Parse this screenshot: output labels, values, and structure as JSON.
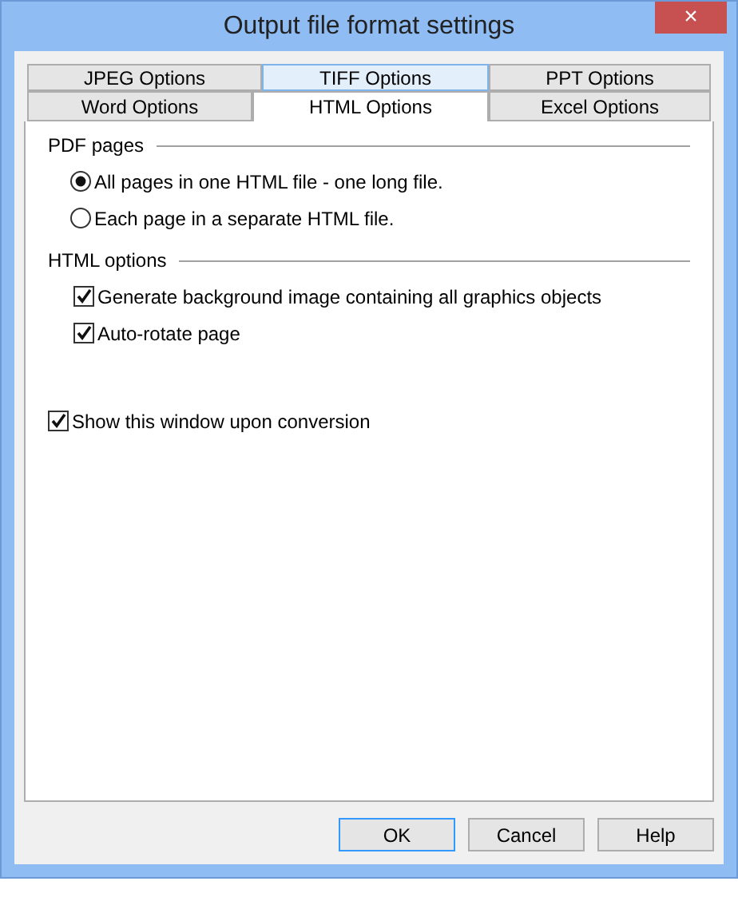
{
  "window": {
    "title": "Output file format settings",
    "close": "×"
  },
  "tab_rows": [
    [
      {
        "label": "JPEG Options",
        "selected": false,
        "hovered": false
      },
      {
        "label": "TIFF Options",
        "selected": false,
        "hovered": true
      },
      {
        "label": "PPT Options",
        "selected": false,
        "hovered": false
      }
    ],
    [
      {
        "label": "Word Options",
        "selected": false,
        "hovered": false
      },
      {
        "label": "HTML Options",
        "selected": true,
        "hovered": false
      },
      {
        "label": "Excel Options",
        "selected": false,
        "hovered": false
      }
    ]
  ],
  "groups": [
    {
      "title": "PDF pages",
      "options": [
        {
          "kind": "radio",
          "label": "All pages in one HTML file - one long file.",
          "checked": true
        },
        {
          "kind": "radio",
          "label": "Each page in a separate HTML file.",
          "checked": false
        }
      ]
    },
    {
      "title": "HTML options",
      "options": [
        {
          "kind": "checkbox",
          "label": "Generate background image containing all graphics objects",
          "checked": true
        },
        {
          "kind": "checkbox",
          "label": "Auto-rotate page",
          "checked": true
        }
      ]
    }
  ],
  "show_window": {
    "label": "Show this window upon conversion",
    "checked": true
  },
  "buttons": [
    {
      "label": "OK",
      "default": true
    },
    {
      "label": "Cancel",
      "default": false
    },
    {
      "label": "Help",
      "default": false
    }
  ]
}
